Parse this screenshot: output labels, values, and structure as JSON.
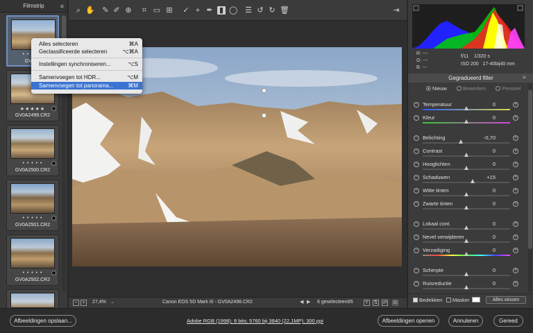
{
  "filmstrip": {
    "title": "Filmstrip",
    "thumbnails": [
      {
        "name": "GV0A2498.CR2",
        "stars": "• • • • •",
        "selected": true
      },
      {
        "name": "GV0A2499.CR2",
        "stars": "★★★★★",
        "selected": false
      },
      {
        "name": "GV0A2500.CR2",
        "stars": "• • • • •",
        "selected": false
      },
      {
        "name": "GV0A2501.CR2",
        "stars": "• • • • •",
        "selected": false
      },
      {
        "name": "GV0A2502.CR2",
        "stars": "• • • • •",
        "selected": false
      }
    ],
    "first_thumb_name_visible": "GV0A2"
  },
  "context_menu": {
    "items": [
      {
        "label": "Alles selecteren",
        "shortcut": "⌘A"
      },
      {
        "label": "Geclassificeerde selecteren",
        "shortcut": "⌥⌘A"
      },
      {
        "label": "Instellingen synchroniseren...",
        "shortcut": "⌥S"
      },
      {
        "label": "Samenvoegen tot HDR...",
        "shortcut": "⌥M"
      },
      {
        "label": "Samenvoegen tot panorama...",
        "shortcut": "⌘M"
      }
    ]
  },
  "toolbar": {
    "icons": [
      "zoom-icon",
      "hand-icon",
      "white-balance-icon",
      "color-sampler-icon",
      "target-adjust-icon",
      "crop-icon",
      "straighten-icon",
      "transform-icon",
      "spot-removal-icon",
      "red-eye-icon",
      "adjustment-brush-icon",
      "graduated-filter-icon",
      "radial-filter-icon",
      "preferences-icon",
      "rotate-left-icon",
      "rotate-right-icon",
      "trash-icon"
    ],
    "right_icon": "fullscreen-icon"
  },
  "statusbar": {
    "zoom": "27,4%",
    "camera": "Canon EOS 5D Mark III  -  GV0A2498.CR2",
    "selection": "6 geselecteerd/6",
    "y_button": "Y"
  },
  "right_panel": {
    "rgb": {
      "r": "R:  ---",
      "g": "G:  ---",
      "b": "B:  ---"
    },
    "camera_info": {
      "aperture": "f/11",
      "shutter": "1/320 s",
      "iso": "ISO 200",
      "lens": "17-40bij40 mm"
    },
    "panel_title": "Gegradueerd filter",
    "modes": [
      {
        "label": "Nieuw",
        "on": true
      },
      {
        "label": "Bewerken",
        "on": false
      },
      {
        "label": "Penseel",
        "on": false
      }
    ],
    "sliders": [
      {
        "label": "Temperatuur",
        "value": "0",
        "pos": 0.5,
        "track": "temp"
      },
      {
        "label": "Kleur",
        "value": "0",
        "pos": 0.5,
        "track": "tint"
      },
      {
        "label": "Belichting",
        "value": "-0,70",
        "pos": 0.44,
        "track": "gray"
      },
      {
        "label": "Contrast",
        "value": "0",
        "pos": 0.5,
        "track": "gray"
      },
      {
        "label": "Hooglichten",
        "value": "0",
        "pos": 0.5,
        "track": "gray"
      },
      {
        "label": "Schaduwen",
        "value": "+15",
        "pos": 0.57,
        "track": "gray"
      },
      {
        "label": "Witte tinten",
        "value": "0",
        "pos": 0.5,
        "track": "gray"
      },
      {
        "label": "Zwarte tinten",
        "value": "0",
        "pos": 0.5,
        "track": "gray"
      },
      {
        "label": "Lokaal cont.",
        "value": "0",
        "pos": 0.5,
        "track": "gray"
      },
      {
        "label": "Nevel verwijderen",
        "value": "0",
        "pos": 0.5,
        "track": "gray"
      },
      {
        "label": "Verzadiging",
        "value": "0",
        "pos": 0.5,
        "track": "sat"
      },
      {
        "label": "Scherpte",
        "value": "0",
        "pos": 0.5,
        "track": "gray"
      },
      {
        "label": "Ruisreductie",
        "value": "0",
        "pos": 0.5,
        "track": "gray"
      }
    ],
    "mask_row": {
      "overlay_label": "Bedekken",
      "overlay_checked": true,
      "mask_label": "Masker",
      "mask_checked": false,
      "clear_label": "Alles wissen"
    }
  },
  "footer": {
    "save_label": "Afbeeldingen opslaan...",
    "workflow_text": "Adobe RGB (1998); 8 bits; 5760 bij 3840 (22,1MP); 300 ppi",
    "open_label": "Afbeeldingen openen",
    "cancel_label": "Annuleren",
    "done_label": "Gereed"
  }
}
